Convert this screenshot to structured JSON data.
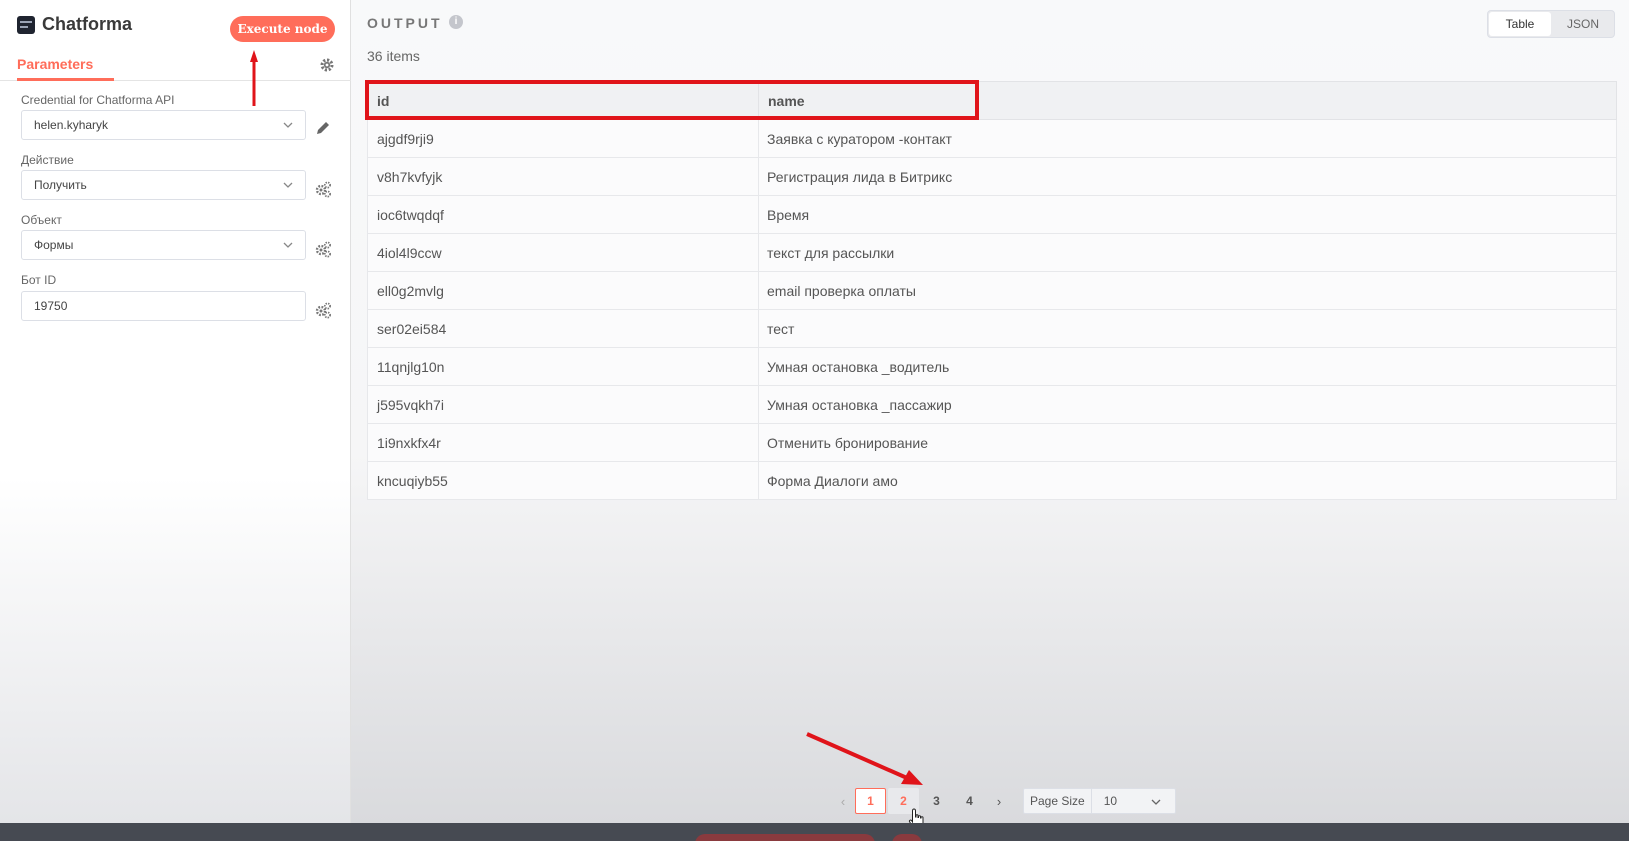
{
  "node": {
    "title": "Chatforma",
    "execute_label": "Execute node"
  },
  "tabs": {
    "parameters": "Parameters"
  },
  "fields": [
    {
      "label": "Credential for Chatforma API",
      "value": "helen.kyharyk",
      "type": "select",
      "side_icon": "pencil-icon"
    },
    {
      "label": "Действие",
      "value": "Получить",
      "type": "select",
      "side_icon": "gears-icon"
    },
    {
      "label": "Объект",
      "value": "Формы",
      "type": "select",
      "side_icon": "gears-icon"
    },
    {
      "label": "Бот ID",
      "value": "19750",
      "type": "input",
      "side_icon": "gears-icon"
    }
  ],
  "output": {
    "title": "OUTPUT",
    "items_count": "36 items",
    "view_toggle": [
      "Table",
      "JSON"
    ],
    "columns": [
      "id",
      "name"
    ],
    "rows": [
      [
        "ajgdf9rji9",
        "Заявка с куратором -контакт"
      ],
      [
        "v8h7kvfyjk",
        "Регистрация лида в Битрикс"
      ],
      [
        "ioc6twqdqf",
        "Время"
      ],
      [
        "4iol4l9ccw",
        "текст для рассылки"
      ],
      [
        "ell0g2mvlg",
        " email проверка оплаты"
      ],
      [
        "ser02ei584",
        "тест"
      ],
      [
        "11qnjlg10n",
        "Умная остановка _водитель"
      ],
      [
        "j595vqkh7i",
        "Умная остановка _пассажир"
      ],
      [
        "1i9nxkfx4r",
        "Отменить бронирование"
      ],
      [
        "kncuqiyb55",
        "Форма Диалоги амо"
      ]
    ]
  },
  "pagination": {
    "prev": "‹",
    "next": "›",
    "pages": [
      "1",
      "2",
      "3",
      "4"
    ],
    "current": "1",
    "page_size_label": "Page Size",
    "page_size_value": "10"
  },
  "colors": {
    "accent": "#ff6d5a",
    "annotation_red": "#e0141a"
  }
}
